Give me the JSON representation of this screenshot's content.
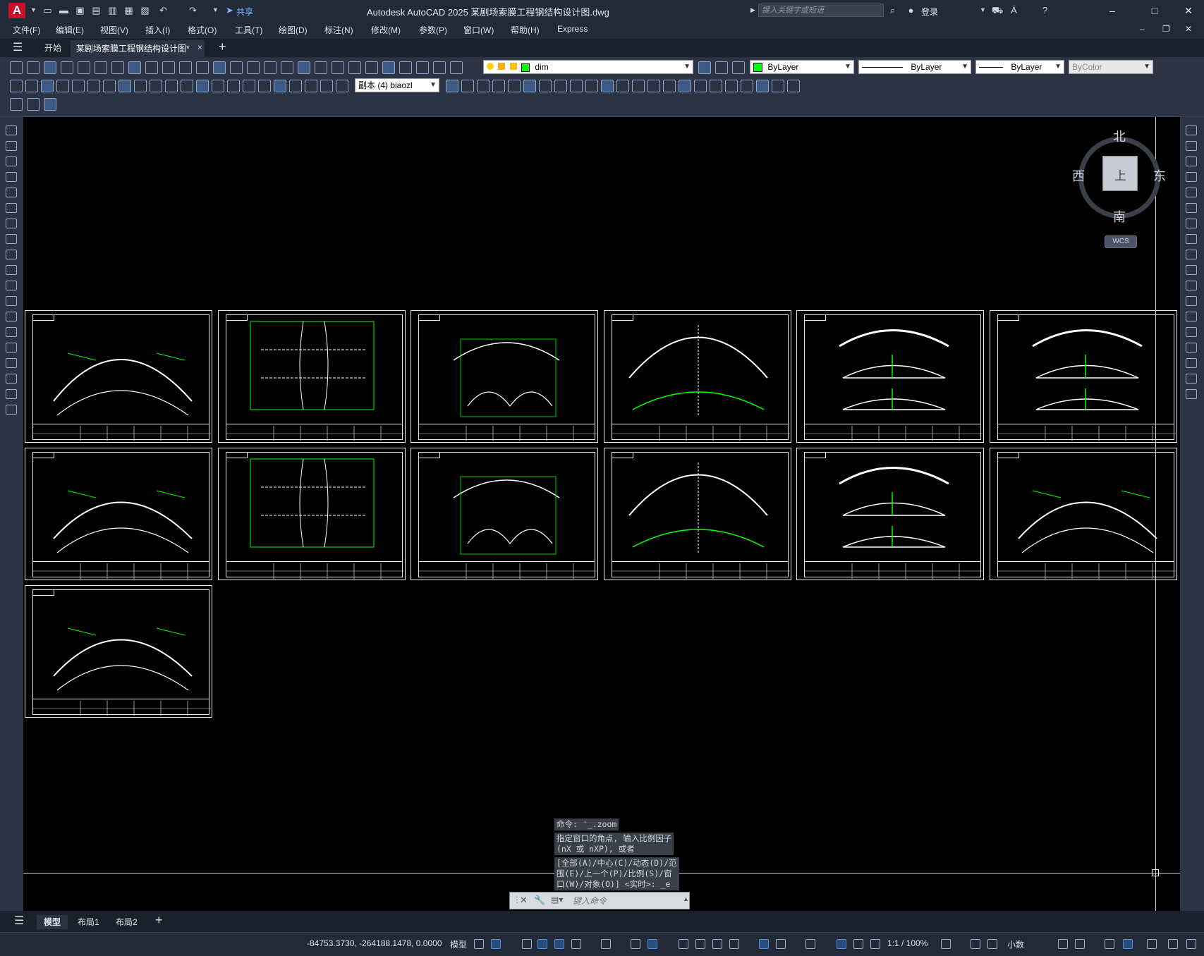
{
  "app": {
    "logo_letter": "A",
    "title": "Autodesk AutoCAD 2025    某剧场索膜工程钢结构设计图.dwg",
    "share_label": "共享",
    "search_placeholder": "键入关键字或短语",
    "login_label": "登录",
    "window_controls": [
      "minimize-icon",
      "maximize-icon",
      "close-icon"
    ]
  },
  "menu": {
    "items": [
      "文件(F)",
      "编辑(E)",
      "视图(V)",
      "插入(I)",
      "格式(O)",
      "工具(T)",
      "绘图(D)",
      "标注(N)",
      "修改(M)",
      "参数(P)",
      "窗口(W)",
      "帮助(H)",
      "Express"
    ]
  },
  "doc_tabs": {
    "start": "开始",
    "active": "某剧场索膜工程钢结构设计图*",
    "close_glyph": "×",
    "add_glyph": "+"
  },
  "properties": {
    "layer_name": "dim",
    "layer_color": "#00ff00",
    "color_label": "ByLayer",
    "linetype_label": "ByLayer",
    "lineweight_label": "ByLayer",
    "plotstyle_label": "ByColor",
    "dimstyle_label": "副本 (4) biaozl"
  },
  "viewcube": {
    "north": "北",
    "south": "南",
    "west": "西",
    "east": "东",
    "top_face": "上",
    "wcs": "WCS"
  },
  "command": {
    "history": [
      "命令: '_.zoom",
      "指定窗口的角点, 输入比例因子\n(nX 或 nXP), 或者",
      "[全部(A)/中心(C)/动态(D)/范\n围(E)/上一个(P)/比例(S)/窗\n口(W)/对象(O)] <实时>: _e"
    ],
    "placeholder": "键入命令"
  },
  "layout_tabs": [
    "模型",
    "布局1",
    "布局2"
  ],
  "status": {
    "coords": "-84753.3730, -264188.1478, 0.0000",
    "model_label": "模型",
    "scale_label": "1:1 / 100%",
    "units_label": "小数"
  },
  "drawing": {
    "sheets_count": 13,
    "accent_color": "#00ff00"
  }
}
